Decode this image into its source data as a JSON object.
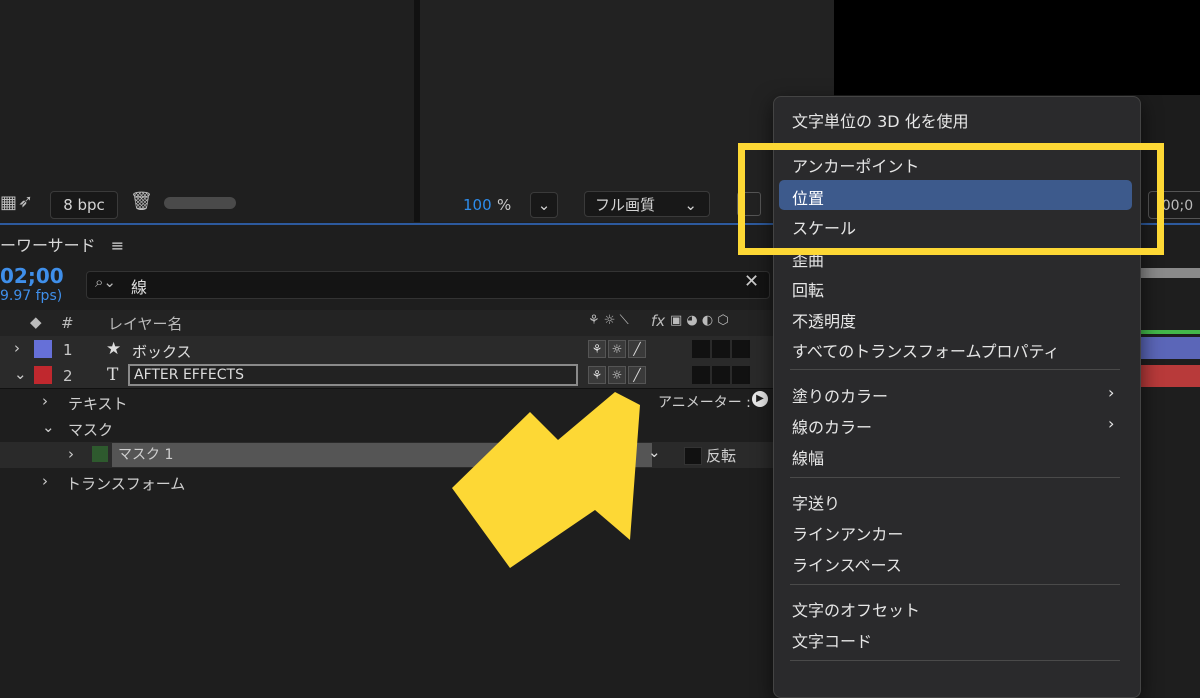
{
  "viewer": {
    "bpc": "8 bpc",
    "zoom_value": "100",
    "zoom_unit": "%",
    "quality": "フル画質",
    "timecode_right": ";00;0"
  },
  "timeline": {
    "comp_tab": "ーワーサード",
    "menu_icon": "≡",
    "timecode": "02;00",
    "fps": "9.97 fps)",
    "search_value": "線",
    "header": {
      "num": "#",
      "layer_name": "レイヤー名",
      "fx": "fx"
    },
    "layers": [
      {
        "num": "1",
        "type_icon": "★",
        "name": "ボックス",
        "color": "#6670d8"
      },
      {
        "num": "2",
        "type_icon": "T",
        "name": "AFTER EFFECTS",
        "color": "#c0282e"
      }
    ],
    "props": {
      "text": "テキスト",
      "mask": "マスク",
      "mask1": "マスク 1",
      "transform": "トランスフォーム",
      "animate": "アニメーター :",
      "invert": "反転"
    }
  },
  "menu": {
    "items": [
      "文字単位の 3D 化を使用",
      "アンカーポイント",
      "位置",
      "スケール",
      "歪曲",
      "回転",
      "不透明度",
      "すべてのトランスフォームプロパティ",
      "塗りのカラー",
      "線のカラー",
      "線幅",
      "字送り",
      "ラインアンカー",
      "ラインスペース",
      "文字のオフセット",
      "文字コード"
    ],
    "highlighted": "位置"
  },
  "colors": {
    "accent": "#3f8fea",
    "highlight": "#3d5a8c",
    "callout": "#fdd835"
  }
}
